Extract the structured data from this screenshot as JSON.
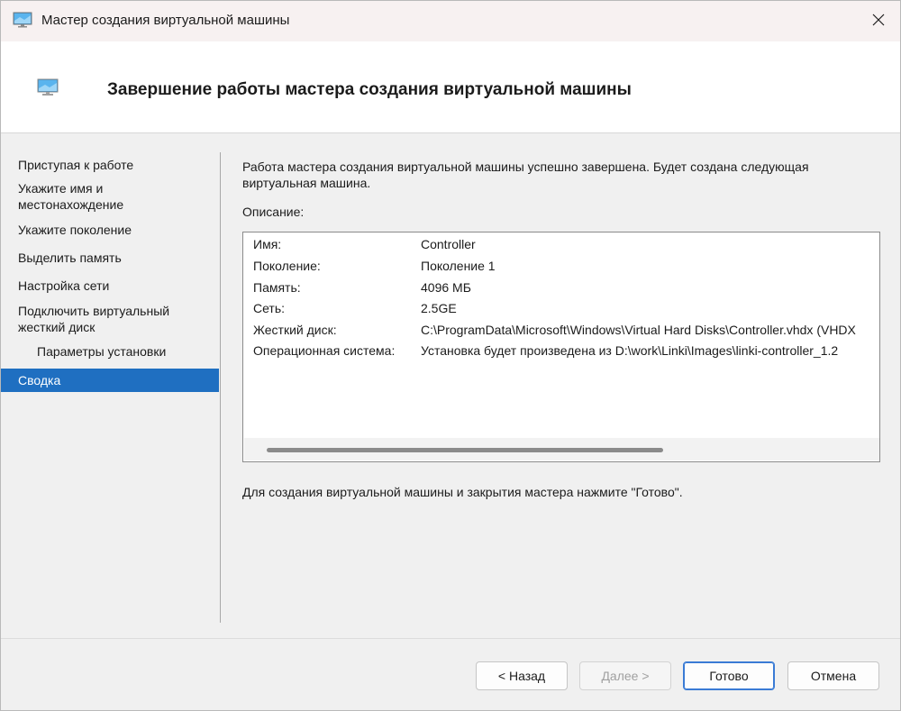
{
  "window": {
    "title": "Мастер создания виртуальной машины",
    "icon": "monitor-icon"
  },
  "header": {
    "heading": "Завершение работы мастера создания виртуальной машины",
    "icon": "monitor-icon"
  },
  "nav": {
    "items": [
      {
        "label": "Приступая к работе"
      },
      {
        "label": "Укажите имя и местонахождение"
      },
      {
        "label": "Укажите поколение"
      },
      {
        "label": "Выделить память"
      },
      {
        "label": "Настройка сети"
      },
      {
        "label": "Подключить виртуальный жесткий диск"
      },
      {
        "label": "Параметры установки"
      },
      {
        "label": "Сводка"
      }
    ],
    "active_index": 7
  },
  "main": {
    "intro": "Работа мастера создания виртуальной машины успешно завершена. Будет создана следующая виртуальная машина.",
    "description_label": "Описание:",
    "summary": [
      {
        "key": "Имя:",
        "value": "Controller"
      },
      {
        "key": "Поколение:",
        "value": "Поколение 1"
      },
      {
        "key": "Память:",
        "value": "4096 МБ"
      },
      {
        "key": "Сеть:",
        "value": "2.5GE"
      },
      {
        "key": "Жесткий диск:",
        "value": "C:\\ProgramData\\Microsoft\\Windows\\Virtual Hard Disks\\Controller.vhdx (VHDX"
      },
      {
        "key": "Операционная система:",
        "value": "Установка будет произведена из D:\\work\\Linki\\Images\\linki-controller_1.2"
      }
    ],
    "finish_note": "Для создания виртуальной машины и закрытия мастера нажмите \"Готово\"."
  },
  "footer": {
    "back_label": "< Назад",
    "next_label": "Далее >",
    "finish_label": "Готово",
    "cancel_label": "Отмена"
  },
  "colors": {
    "accent": "#1f6fc1",
    "title_bar": "#f7f1f1"
  }
}
